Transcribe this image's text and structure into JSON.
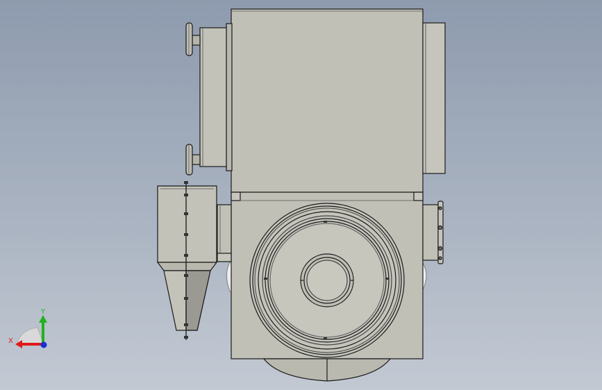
{
  "viewport": {
    "background_top": "#8e9bae",
    "background_bottom": "#c3c9d3"
  },
  "model": {
    "body_color": "#c0c0b7",
    "edge_color": "#1a1a1a",
    "shade_color": "#a9a9a0"
  },
  "triad": {
    "x_label": "X",
    "y_label": "Y",
    "x_color": "#e01a1a",
    "y_color": "#1fb31f",
    "z_color": "#1a2fd6"
  }
}
